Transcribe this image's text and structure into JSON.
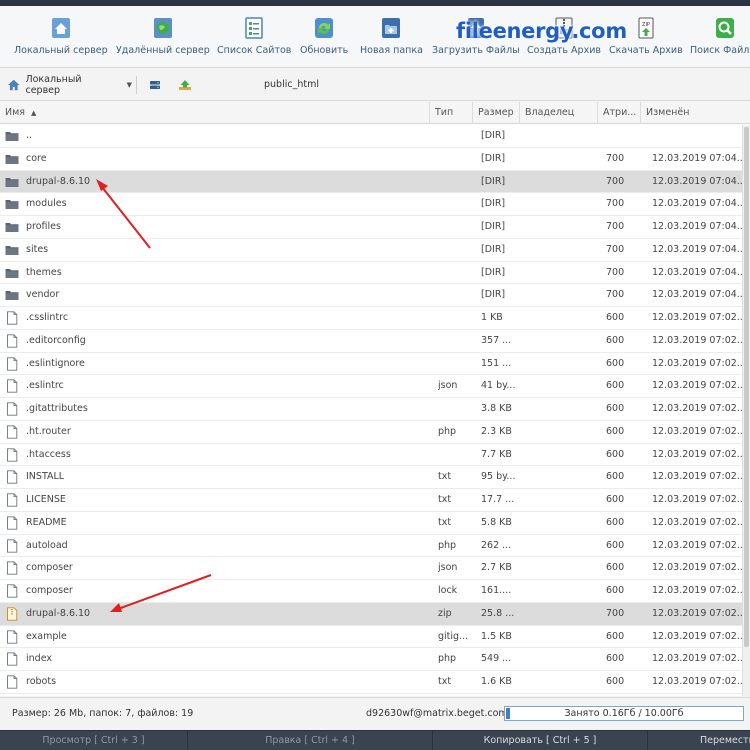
{
  "toolbar": {
    "buttons": [
      {
        "label": "Локальный сервер",
        "icon": "home-icon"
      },
      {
        "label": "Удалённый сервер",
        "icon": "globe-icon"
      },
      {
        "label": "Список Сайтов",
        "icon": "site-list-icon"
      },
      {
        "label": "Обновить",
        "icon": "refresh-icon"
      },
      {
        "label": "Новая папка",
        "icon": "new-folder-icon"
      },
      {
        "label": "Загрузить Файлы",
        "icon": "upload-icon"
      },
      {
        "label": "Создать Архив",
        "icon": "create-archive-icon"
      },
      {
        "label": "Скачать Архив",
        "icon": "download-archive-icon"
      },
      {
        "label": "Поиск Файлов",
        "icon": "search-icon"
      }
    ]
  },
  "watermark": "fileenergy.com",
  "pathbar": {
    "server": "Локальный сервер",
    "path": "public_html"
  },
  "columns": {
    "name": "Имя",
    "type": "Тип",
    "size": "Размер",
    "owner": "Владелец",
    "attr": "Атри...",
    "modified": "Изменён"
  },
  "rows": [
    {
      "name": "..",
      "type": "",
      "size": "[DIR]",
      "attr": "",
      "modified": "",
      "kind": "folder"
    },
    {
      "name": "core",
      "type": "",
      "size": "[DIR]",
      "attr": "700",
      "modified": "12.03.2019 07:04...",
      "kind": "folder"
    },
    {
      "name": "drupal-8.6.10",
      "type": "",
      "size": "[DIR]",
      "attr": "700",
      "modified": "12.03.2019 07:04...",
      "kind": "folder"
    },
    {
      "name": "modules",
      "type": "",
      "size": "[DIR]",
      "attr": "700",
      "modified": "12.03.2019 07:04...",
      "kind": "folder"
    },
    {
      "name": "profiles",
      "type": "",
      "size": "[DIR]",
      "attr": "700",
      "modified": "12.03.2019 07:04...",
      "kind": "folder"
    },
    {
      "name": "sites",
      "type": "",
      "size": "[DIR]",
      "attr": "700",
      "modified": "12.03.2019 07:04...",
      "kind": "folder"
    },
    {
      "name": "themes",
      "type": "",
      "size": "[DIR]",
      "attr": "700",
      "modified": "12.03.2019 07:04...",
      "kind": "folder"
    },
    {
      "name": "vendor",
      "type": "",
      "size": "[DIR]",
      "attr": "700",
      "modified": "12.03.2019 07:04...",
      "kind": "folder"
    },
    {
      "name": ".csslintrc",
      "type": "",
      "size": "1 KB",
      "attr": "600",
      "modified": "12.03.2019 07:02...",
      "kind": "file"
    },
    {
      "name": ".editorconfig",
      "type": "",
      "size": "357 ...",
      "attr": "600",
      "modified": "12.03.2019 07:02...",
      "kind": "file"
    },
    {
      "name": ".eslintignore",
      "type": "",
      "size": "151 ...",
      "attr": "600",
      "modified": "12.03.2019 07:02...",
      "kind": "file"
    },
    {
      "name": ".eslintrc",
      "type": "json",
      "size": "41 by...",
      "attr": "600",
      "modified": "12.03.2019 07:02...",
      "kind": "file"
    },
    {
      "name": ".gitattributes",
      "type": "",
      "size": "3.8 KB",
      "attr": "600",
      "modified": "12.03.2019 07:02...",
      "kind": "file"
    },
    {
      "name": ".ht.router",
      "type": "php",
      "size": "2.3 KB",
      "attr": "600",
      "modified": "12.03.2019 07:02...",
      "kind": "file"
    },
    {
      "name": ".htaccess",
      "type": "",
      "size": "7.7 KB",
      "attr": "600",
      "modified": "12.03.2019 07:02...",
      "kind": "file"
    },
    {
      "name": "INSTALL",
      "type": "txt",
      "size": "95 by...",
      "attr": "600",
      "modified": "12.03.2019 07:02...",
      "kind": "file"
    },
    {
      "name": "LICENSE",
      "type": "txt",
      "size": "17.7 ...",
      "attr": "600",
      "modified": "12.03.2019 07:02...",
      "kind": "file"
    },
    {
      "name": "README",
      "type": "txt",
      "size": "5.8 KB",
      "attr": "600",
      "modified": "12.03.2019 07:02...",
      "kind": "file"
    },
    {
      "name": "autoload",
      "type": "php",
      "size": "262 ...",
      "attr": "600",
      "modified": "12.03.2019 07:02...",
      "kind": "file"
    },
    {
      "name": "composer",
      "type": "json",
      "size": "2.7 KB",
      "attr": "600",
      "modified": "12.03.2019 07:02...",
      "kind": "file"
    },
    {
      "name": "composer",
      "type": "lock",
      "size": "161....",
      "attr": "600",
      "modified": "12.03.2019 07:02...",
      "kind": "file"
    },
    {
      "name": "drupal-8.6.10",
      "type": "zip",
      "size": "25.8 ...",
      "attr": "700",
      "modified": "12.03.2019 07:02...",
      "kind": "archive"
    },
    {
      "name": "example",
      "type": "gitig...",
      "size": "1.5 KB",
      "attr": "600",
      "modified": "12.03.2019 07:02...",
      "kind": "file"
    },
    {
      "name": "index",
      "type": "php",
      "size": "549 ...",
      "attr": "600",
      "modified": "12.03.2019 07:02...",
      "kind": "file"
    },
    {
      "name": "robots",
      "type": "txt",
      "size": "1.6 KB",
      "attr": "600",
      "modified": "12.03.2019 07:02...",
      "kind": "file"
    }
  ],
  "selected_rows": [
    2,
    21
  ],
  "status": {
    "summary": "Размер: 26 Mb, папок: 7, файлов: 19",
    "account": "d92630wf@matrix.beget.com",
    "quota_text": "Занято 0.16Гб / 10.00Гб",
    "quota_fraction": 0.016
  },
  "fkeys": [
    {
      "label": "Просмотр [ Ctrl + 3 ]",
      "disabled": true
    },
    {
      "label": "Правка [ Ctrl + 4 ]",
      "disabled": true
    },
    {
      "label": "Копировать [ Ctrl + 5 ]",
      "disabled": false
    },
    {
      "label": "Перемести",
      "disabled": false
    }
  ],
  "colors": {
    "accent": "#3d7fc1",
    "annotation_arrow": "#e02020",
    "watermark": "#1f5fc4"
  }
}
